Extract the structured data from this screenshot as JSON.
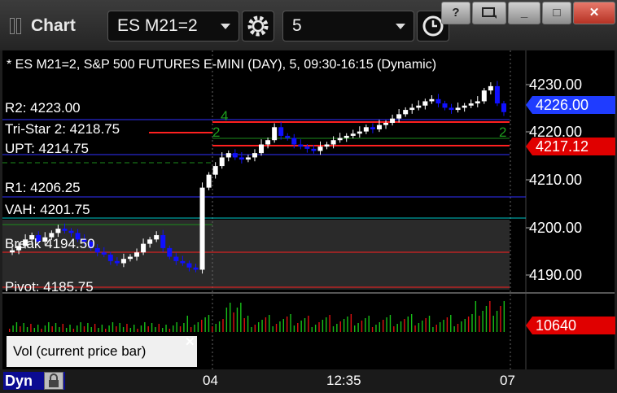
{
  "app": {
    "title": "Chart"
  },
  "toolbar": {
    "symbol": "ES M21=2",
    "interval": "5"
  },
  "window_buttons": {
    "help": "?",
    "minimize": "_",
    "maximize": "□",
    "close": "✕"
  },
  "chart": {
    "info": "* ES M21=2, S&P 500 FUTURES E-MINI (DAY), 5, 09:30-16:15 (Dynamic)",
    "levels": [
      {
        "label": "R2: 4223.00",
        "price": 4223.0
      },
      {
        "label": "Tri-Star 2: 4218.75",
        "price": 4218.75
      },
      {
        "label": "UPT: 4214.75",
        "price": 4214.75
      },
      {
        "label": "R1: 4206.25",
        "price": 4206.25
      },
      {
        "label": "VAH: 4201.75",
        "price": 4201.75
      },
      {
        "label": "Break 4194.50",
        "price": 4194.5
      },
      {
        "label": "Pivot: 4185.75",
        "price": 4185.75
      }
    ],
    "price_axis": [
      "4230.00",
      "4220.00",
      "4210.00",
      "4200.00",
      "4190.00"
    ],
    "last_price": "4226.00",
    "marker_price": "4217.12",
    "volume_label": "10640",
    "volume_panel_label": "Vol (current price bar)",
    "time_axis": [
      "04",
      "12:35",
      "07"
    ],
    "status": {
      "mode": "Dyn"
    },
    "colors": {
      "background": "#000084",
      "up_candle": "#ffffff",
      "down_candle": "#1010ff",
      "last_tag": "#1f3cff",
      "marker_tag": "#e00000"
    }
  },
  "chart_data": {
    "type": "candlestick",
    "y_range": [
      4184,
      4236
    ],
    "close_path": [
      4193.5,
      4194.5,
      4196,
      4197,
      4195.5,
      4196.5,
      4197.5,
      4198.5,
      4198.0,
      4197.5,
      4196,
      4195.5,
      4194,
      4193,
      4192.5,
      4191,
      4190.5,
      4191.5,
      4192,
      4193,
      4195,
      4196,
      4197,
      4194,
      4192,
      4191,
      4190.5,
      4189.5,
      4189,
      4208,
      4211,
      4213,
      4215,
      4216,
      4215,
      4214.5,
      4215,
      4216,
      4218,
      4219,
      4222,
      4220,
      4219.5,
      4218,
      4217.5,
      4217,
      4216.5,
      4217.5,
      4218,
      4219,
      4219.5,
      4220,
      4220.5,
      4221,
      4222,
      4221.5,
      4222.5,
      4223,
      4224,
      4225,
      4226,
      4226.5,
      4227,
      4228,
      4228.5,
      4227.5,
      4226.5,
      4226,
      4226.5,
      4227,
      4227.5,
      4228,
      4230.5,
      4231.5,
      4227.5,
      4225.5
    ],
    "volume_tag": 10640
  }
}
